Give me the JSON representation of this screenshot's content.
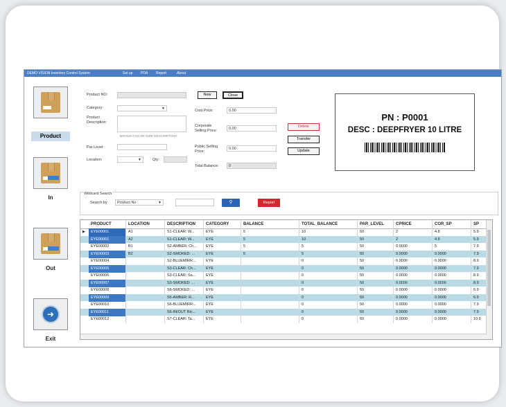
{
  "menubar": {
    "title": "DEMO VISION Inventory Control System",
    "items": [
      "Set up",
      "PDA",
      "Report",
      "About"
    ]
  },
  "sidebar": {
    "items": [
      {
        "label": "Product",
        "icon": "box-icon"
      },
      {
        "label": "In",
        "icon": "box-in-icon"
      },
      {
        "label": "Out",
        "icon": "box-out-icon"
      },
      {
        "label": "Exit",
        "icon": "exit-icon"
      }
    ]
  },
  "form": {
    "product_no_label": "Product NO:",
    "product_no_value": "",
    "category_label": "Category:",
    "category_value": "",
    "product_desc_label_1": "Product",
    "product_desc_label_2": "Description:",
    "desc_hint": "BRAND-COLOR-SIZE DESCRIPTION",
    "par_level_label": "Par Level:",
    "par_level_value": "",
    "location_label": "Location:",
    "location_value": "",
    "qty_label": "Qty:",
    "qty_value": "",
    "cost_price_label": "Cost Price:",
    "cost_price_value": "0.00",
    "corp_label_1": "Corporate",
    "corp_label_2": "Selling Price:",
    "corp_value": "0.00",
    "public_label_1": "Public Selling",
    "public_label_2": "Price:",
    "public_value": "0.00",
    "total_balance_label": "Total Balance:",
    "total_balance_value": "0"
  },
  "buttons": {
    "new": "New",
    "close": "Close",
    "delete": "Delete",
    "transfer": "Transfer",
    "update": "Update",
    "report": "Report"
  },
  "label_preview": {
    "pn": "PN : P0001",
    "desc": "DESC : DEEPFRYER 10 LITRE"
  },
  "search": {
    "group_label": "Wildcard Search",
    "search_by_label": "Search by :",
    "search_by_value": "Product No",
    "query": ""
  },
  "table": {
    "columns": [
      "PRODUCT",
      "LOCATION",
      "DESCRIPTION",
      "CATEGORY",
      "BALANCE",
      "TOTAL_BALANCE",
      "PAR_LEVEL",
      "CPRICE",
      "COR_SP",
      "SP"
    ],
    "rows": [
      [
        "EYE00001",
        "A1",
        "S1-CLEAR: W...",
        "EYE",
        "5",
        "10",
        "50",
        "2",
        "4.8",
        "5.9"
      ],
      [
        "EYE00001",
        "A2",
        "S1-CLEAR: W...",
        "EYE",
        "5",
        "10",
        "50",
        "2",
        "4.8",
        "5.9"
      ],
      [
        "EYE00002",
        "B1",
        "S2-AMBER: Ch...",
        "EYE",
        "5",
        "5",
        "50",
        "0.0000",
        "5",
        "7.9"
      ],
      [
        "EYE00003",
        "B2",
        "S2-SMOKED: ...",
        "EYE",
        "5",
        "5",
        "50",
        "0.0000",
        "0.0000",
        "7.9"
      ],
      [
        "EYE00004",
        "",
        "S2-BLUEMIRR...",
        "EYE",
        "",
        "0",
        "50",
        "0.0000",
        "0.0000",
        "8.9"
      ],
      [
        "EYE00005",
        "",
        "S3-CLEAR: Ch...",
        "EYE",
        "",
        "0",
        "50",
        "0.0000",
        "0.0000",
        "7.9"
      ],
      [
        "EYE00006",
        "",
        "S3-CLEAR: Sa...",
        "EYE",
        "",
        "0",
        "50",
        "0.0000",
        "0.0000",
        "8.9"
      ],
      [
        "EYE00007",
        "",
        "S3-SMOKED: ...",
        "EYE",
        "",
        "0",
        "50",
        "0.0000",
        "0.0000",
        "8.9"
      ],
      [
        "EYE00008",
        "",
        "S6-SMOKED: ...",
        "EYE",
        "",
        "0",
        "50",
        "0.0000",
        "0.0000",
        "6.9"
      ],
      [
        "EYE00009",
        "",
        "S6-AMBER: R...",
        "EYE",
        "",
        "0",
        "50",
        "0.0000",
        "0.0000",
        "6.9"
      ],
      [
        "EYE00010",
        "",
        "S6-BLUEMIRR...",
        "EYE",
        "",
        "0",
        "50",
        "0.0000",
        "0.0000",
        "7.9"
      ],
      [
        "EYE00011",
        "",
        "S6-IN/OUT Ric...",
        "EYE",
        "",
        "0",
        "50",
        "0.0000",
        "0.0000",
        "7.9"
      ],
      [
        "EYE00012",
        "",
        "S7-CLEAR: Ta...",
        "EYE",
        "",
        "0",
        "50",
        "0.0000",
        "0.0000",
        "10.9"
      ]
    ]
  },
  "colors": {
    "menubar": "#4a7ec5",
    "row_alt": "#b8dbe6",
    "accent_blue": "#2d63b3",
    "accent_red": "#d6262f"
  }
}
